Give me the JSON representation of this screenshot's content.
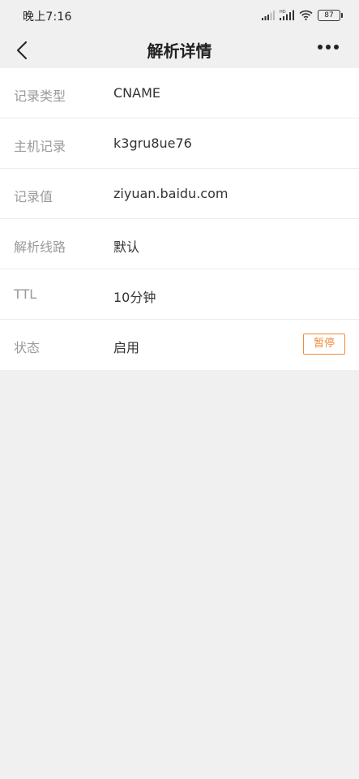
{
  "status_bar": {
    "time": "晚上7:16",
    "battery_level": "87",
    "icons": [
      "signal-icon",
      "hd-signal-icon",
      "wifi-icon",
      "battery-icon"
    ]
  },
  "header": {
    "back_icon": "chevron-left-icon",
    "title": "解析详情",
    "more_icon": "more-dots-icon"
  },
  "record": {
    "rows": [
      {
        "label": "记录类型",
        "value": "CNAME"
      },
      {
        "label": "主机记录",
        "value": "k3gru8ue76"
      },
      {
        "label": "记录值",
        "value": "ziyuan.baidu.com"
      },
      {
        "label": "解析线路",
        "value": "默认"
      },
      {
        "label": "TTL",
        "value": "10分钟"
      },
      {
        "label": "状态",
        "value": "启用"
      }
    ],
    "pause_label": "暂停"
  },
  "colors": {
    "accent": "#f08a3c",
    "background": "#f0f0f0",
    "label": "#9a9a9a",
    "value": "#333333"
  }
}
